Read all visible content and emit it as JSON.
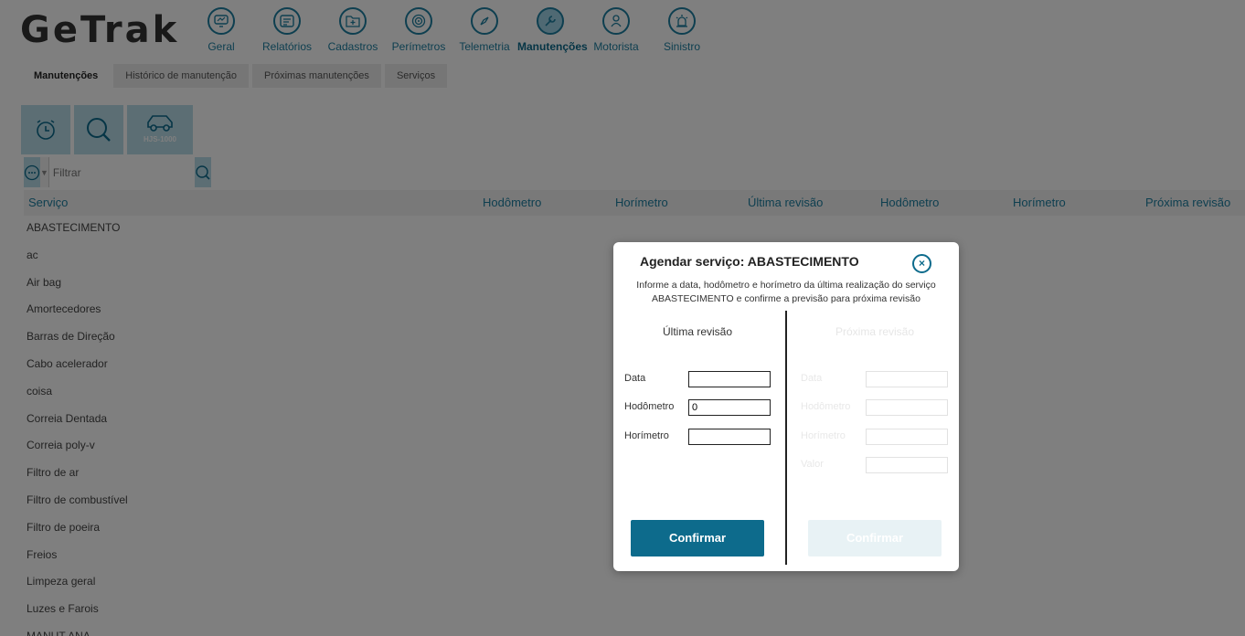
{
  "app": {
    "logo": "GeTrak"
  },
  "nav": [
    {
      "label": "Geral",
      "icon": "monitor-icon",
      "active": false
    },
    {
      "label": "Relatórios",
      "icon": "report-icon",
      "active": false
    },
    {
      "label": "Cadastros",
      "icon": "folder-plus-icon",
      "active": false
    },
    {
      "label": "Perímetros",
      "icon": "target-icon",
      "active": false
    },
    {
      "label": "Telemetria",
      "icon": "compass-icon",
      "active": false
    },
    {
      "label": "Manutenções",
      "icon": "wrench-icon",
      "active": true
    },
    {
      "label": "Motorista",
      "icon": "driver-icon",
      "active": false
    },
    {
      "label": "Sinistro",
      "icon": "alarm-icon",
      "active": false
    }
  ],
  "tabs": [
    {
      "label": "Manutenções",
      "active": true
    },
    {
      "label": "Histórico de manutenção",
      "active": false
    },
    {
      "label": "Próximas manutenções",
      "active": false
    },
    {
      "label": "Serviços",
      "active": false
    }
  ],
  "toolbar": {
    "vehicle_plate": "HJS-1000"
  },
  "filter": {
    "placeholder": "Filtrar"
  },
  "table": {
    "columns": [
      "Serviço",
      "Hodômetro",
      "Horímetro",
      "Última revisão",
      "Hodômetro",
      "Horímetro",
      "Próxima revisão"
    ],
    "rows": [
      "ABASTECIMENTO",
      "ac",
      "Air bag",
      "Amortecedores",
      "Barras de Direção",
      "Cabo acelerador",
      "coisa",
      "Correia Dentada",
      "Correia poly-v",
      "Filtro de ar",
      "Filtro de combustível",
      "Filtro de poeira",
      "Freios",
      "Limpeza geral",
      "Luzes e Farois",
      "MANUT ANA"
    ]
  },
  "modal": {
    "title": "Agendar serviço: ABASTECIMENTO",
    "close_symbol": "×",
    "description": "Informe a data, hodômetro e horímetro da última realização do serviço ABASTECIMENTO e confirme a previsão para próxima revisão",
    "left": {
      "title": "Última revisão",
      "data_label": "Data",
      "data_value": "",
      "hodometro_label": "Hodômetro",
      "hodometro_value": "0",
      "horimetro_label": "Horímetro",
      "horimetro_value": "",
      "confirm_label": "Confirmar"
    },
    "right": {
      "title": "Próxima revisão",
      "data_label": "Data",
      "hodometro_label": "Hodômetro",
      "horimetro_label": "Horímetro",
      "valor_label": "Valor",
      "confirm_label": "Confirmar"
    }
  },
  "colors": {
    "accent": "#0d6b8c",
    "light_accent": "#b8dde9",
    "link": "#1d7ea0"
  }
}
